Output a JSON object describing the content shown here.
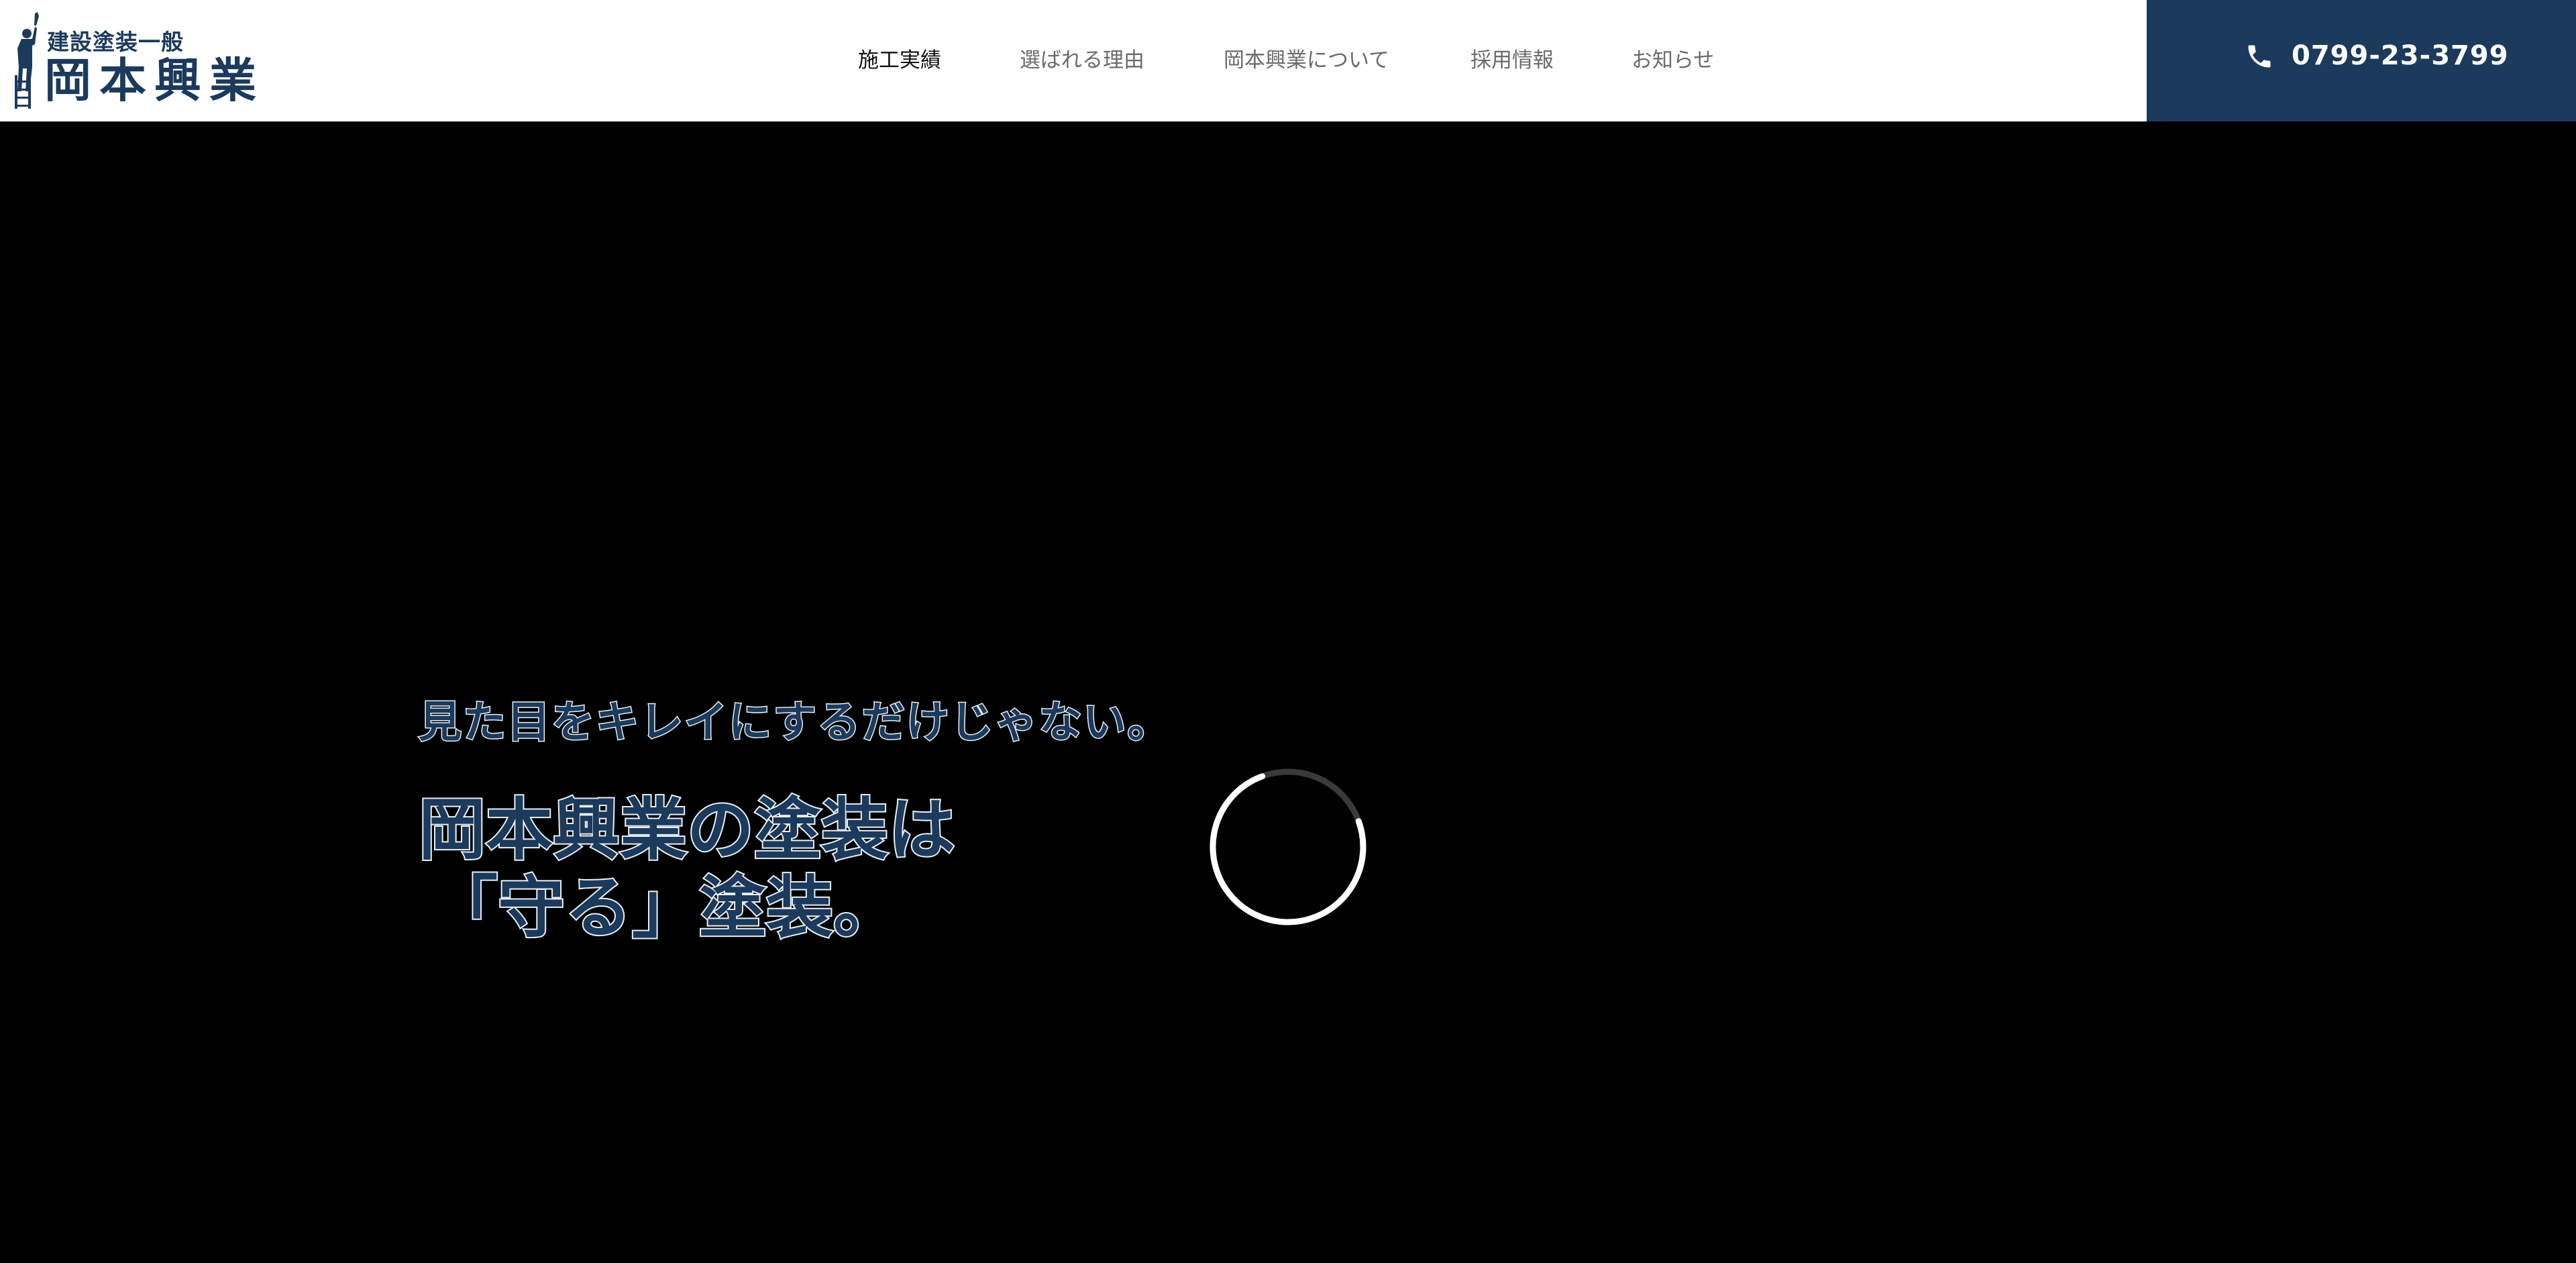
{
  "logo": {
    "subtitle": "建設塗装一般",
    "name": "岡本興業"
  },
  "nav": {
    "items": [
      {
        "label": "施工実績",
        "active": true
      },
      {
        "label": "選ばれる理由",
        "active": false
      },
      {
        "label": "岡本興業について",
        "active": false
      },
      {
        "label": "採用情報",
        "active": false
      },
      {
        "label": "お知らせ",
        "active": false
      }
    ]
  },
  "phone": {
    "icon": "phone-icon",
    "number": "0799-23-3799"
  },
  "hero": {
    "subheading": "見た目をキレイにするだけじゃない。",
    "heading_line1": "岡本興業の塗装は",
    "heading_line2": "「守る」塗装。",
    "loading_indicator": "spinner-icon"
  },
  "colors": {
    "brand_navy": "#1b3a5c",
    "header_bg": "#ffffff",
    "hero_bg": "#000000",
    "nav_text": "#6b6b6b",
    "nav_active": "#111111"
  }
}
